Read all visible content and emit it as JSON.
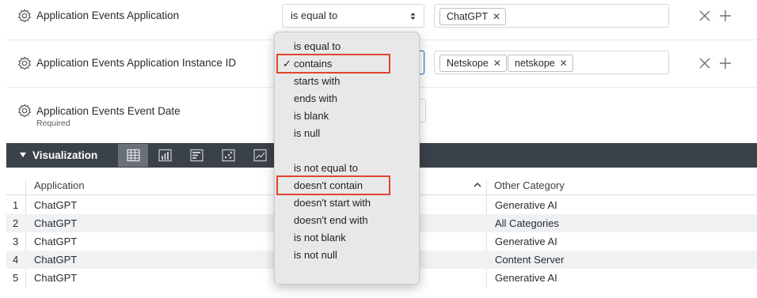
{
  "filters": [
    {
      "label": "Application Events Application",
      "sublabel": "",
      "operator": "is equal to",
      "chips": [
        "ChatGPT"
      ]
    },
    {
      "label": "Application Events Application Instance ID",
      "sublabel": "",
      "operator": "contains",
      "chips": [
        "Netskope",
        "netskope"
      ]
    },
    {
      "label": "Application Events Event Date",
      "sublabel": "Required"
    }
  ],
  "chip_remove_glyph": "✕",
  "visualization": {
    "title": "Visualization",
    "tools": [
      "table-icon",
      "bar-chart-icon",
      "horizontal-bar-icon",
      "scatter-icon",
      "line-chart-icon"
    ]
  },
  "table": {
    "columns": [
      "Application",
      "Other Category"
    ],
    "rows": [
      {
        "num": "1",
        "application": "ChatGPT",
        "other": "Generative AI"
      },
      {
        "num": "2",
        "application": "ChatGPT",
        "other": "All Categories"
      },
      {
        "num": "3",
        "application": "ChatGPT",
        "other": "Generative AI"
      },
      {
        "num": "4",
        "application": "ChatGPT",
        "other": "Content Server"
      },
      {
        "num": "5",
        "application": "ChatGPT",
        "other": "Generative AI"
      }
    ]
  },
  "dropdown": {
    "check_glyph": "✓",
    "group1": [
      "is equal to",
      "contains",
      "starts with",
      "ends with",
      "is blank",
      "is null"
    ],
    "group2": [
      "is not equal to",
      "doesn't contain",
      "doesn't start with",
      "doesn't end with",
      "is not blank",
      "is not null"
    ],
    "selected": "contains",
    "highlighted": [
      "contains",
      "doesn't contain"
    ]
  },
  "colors": {
    "highlight": "#e0462f",
    "viz_bar": "#3b4149",
    "focus": "#3f79c4"
  }
}
